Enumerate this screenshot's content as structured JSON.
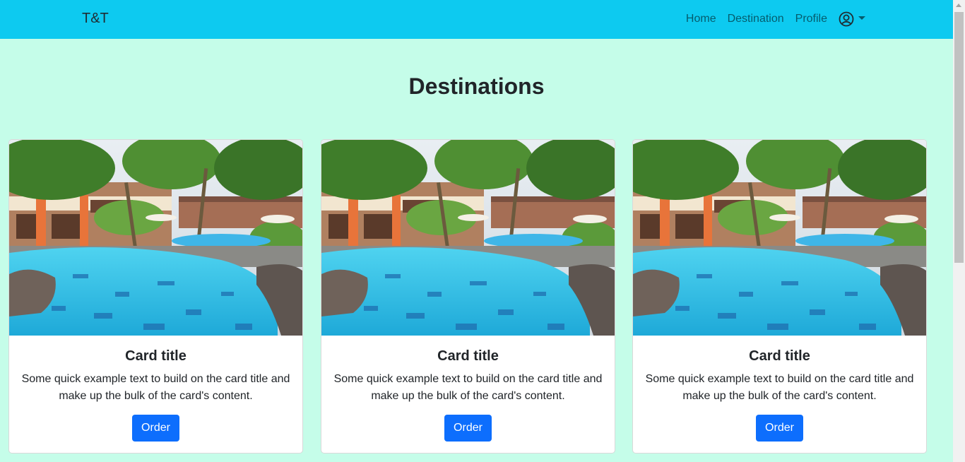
{
  "navbar": {
    "brand": "T&T",
    "links": [
      "Home",
      "Destination",
      "Profile"
    ],
    "user_icon": "user-circle-icon"
  },
  "page": {
    "title": "Destinations"
  },
  "cards": [
    {
      "image_icon": "resort-pool-photo",
      "title": "Card title",
      "text": "Some quick example text to build on the card title and make up the bulk of the card's content.",
      "button": "Order"
    },
    {
      "image_icon": "resort-pool-photo",
      "title": "Card title",
      "text": "Some quick example text to build on the card title and make up the bulk of the card's content.",
      "button": "Order"
    },
    {
      "image_icon": "resort-pool-photo",
      "title": "Card title",
      "text": "Some quick example text to build on the card title and make up the bulk of the card's content.",
      "button": "Order"
    }
  ],
  "colors": {
    "navbar": "#0dcaf0",
    "background": "#c5fde9",
    "button": "#0d6efd"
  }
}
